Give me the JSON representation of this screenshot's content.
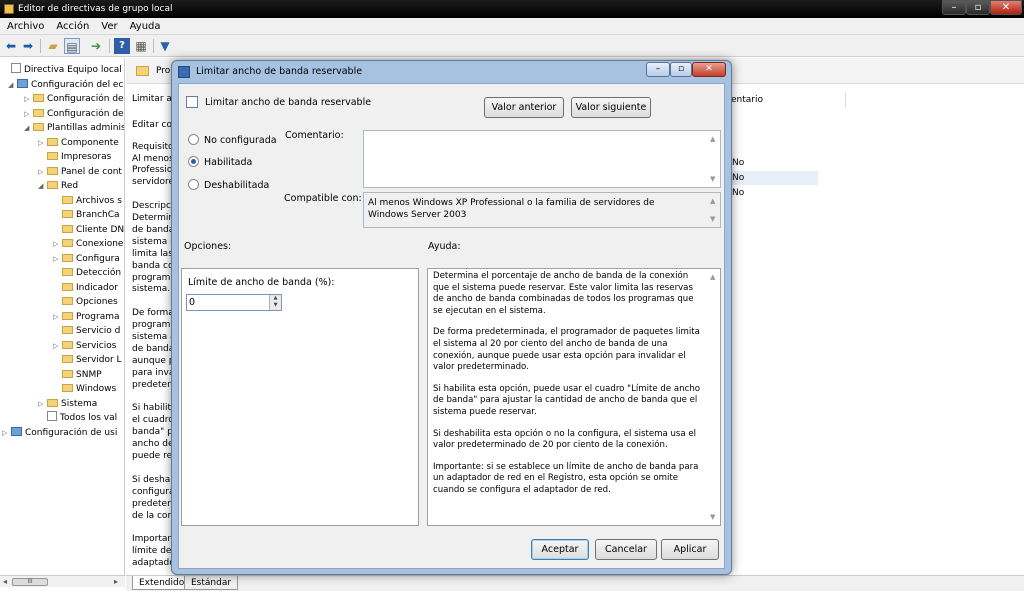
{
  "window": {
    "title": "Editor de directivas de grupo local",
    "minimize": "–",
    "maximize": "▫",
    "close": "✕"
  },
  "menu": {
    "items": [
      "Archivo",
      "Acción",
      "Ver",
      "Ayuda"
    ]
  },
  "toolbar": {
    "icons": [
      "back-arrow-icon",
      "forward-arrow-icon",
      "up-folder-icon",
      "show-hide-tree-icon",
      "export-list-icon",
      "help-icon",
      "properties-icon",
      "filter-icon"
    ]
  },
  "tree": {
    "items": [
      {
        "label": "Directiva Equipo local",
        "level": 0,
        "icon": "doc",
        "exp": ""
      },
      {
        "label": "Configuración del ec",
        "level": 1,
        "icon": "comp",
        "exp": "◢"
      },
      {
        "label": "Configuración de",
        "level": 2,
        "icon": "fold",
        "exp": "▷"
      },
      {
        "label": "Configuración de",
        "level": 2,
        "icon": "fold",
        "exp": "▷"
      },
      {
        "label": "Plantillas adminis",
        "level": 2,
        "icon": "fold",
        "exp": "◢"
      },
      {
        "label": "Componente",
        "level": 3,
        "icon": "fold",
        "exp": "▷"
      },
      {
        "label": "Impresoras",
        "level": 3,
        "icon": "fold",
        "exp": ""
      },
      {
        "label": "Panel de cont",
        "level": 3,
        "icon": "fold",
        "exp": "▷"
      },
      {
        "label": "Red",
        "level": 3,
        "icon": "fold",
        "exp": "◢"
      },
      {
        "label": "Archivos s",
        "level": 4,
        "icon": "fold",
        "exp": ""
      },
      {
        "label": "BranchCa",
        "level": 4,
        "icon": "fold",
        "exp": ""
      },
      {
        "label": "Cliente DN",
        "level": 4,
        "icon": "fold",
        "exp": ""
      },
      {
        "label": "Conexione",
        "level": 4,
        "icon": "fold",
        "exp": "▷"
      },
      {
        "label": "Configura",
        "level": 4,
        "icon": "fold",
        "exp": "▷"
      },
      {
        "label": "Detección",
        "level": 4,
        "icon": "fold",
        "exp": ""
      },
      {
        "label": "Indicador",
        "level": 4,
        "icon": "fold",
        "exp": ""
      },
      {
        "label": "Opciones",
        "level": 4,
        "icon": "fold",
        "exp": ""
      },
      {
        "label": "Programa",
        "level": 4,
        "icon": "fold",
        "exp": "▷"
      },
      {
        "label": "Servicio d",
        "level": 4,
        "icon": "fold",
        "exp": ""
      },
      {
        "label": "Servicios",
        "level": 4,
        "icon": "fold",
        "exp": "▷"
      },
      {
        "label": "Servidor L",
        "level": 4,
        "icon": "fold",
        "exp": ""
      },
      {
        "label": "SNMP",
        "level": 4,
        "icon": "fold",
        "exp": ""
      },
      {
        "label": "Windows",
        "level": 4,
        "icon": "fold",
        "exp": ""
      },
      {
        "label": "Sistema",
        "level": 3,
        "icon": "fold",
        "exp": "▷"
      },
      {
        "label": "Todos los val",
        "level": 3,
        "icon": "doc",
        "exp": ""
      },
      {
        "label": "Configuración de usi",
        "level": 0,
        "icon": "comp",
        "exp": "▷"
      }
    ],
    "scroll_thumb": "III"
  },
  "rightpane": {
    "header_title": "Pro",
    "column_header": "entario",
    "values": [
      "No",
      "No",
      "No"
    ],
    "text_lines": [
      "Limitar a",
      "",
      "Editar co",
      "",
      "Requisito",
      "Al menos",
      "Professio",
      "servidore",
      "",
      "Descripci",
      "Determin",
      "de banda",
      "sistema p",
      "limita las",
      "banda co",
      "programa",
      "sistema.",
      "",
      "De forma",
      "programa",
      "sistema a",
      "de banda",
      "aunque p",
      "para inva",
      "predeterr",
      "",
      "Si habilita",
      "el cuadro",
      "banda\" p",
      "ancho de",
      "puede res",
      "",
      "Si deshab",
      "configura",
      "predeterr",
      "de la con",
      "",
      "Importan",
      "límite de",
      "adaptador"
    ]
  },
  "tabs": [
    "Extendido",
    "Estándar"
  ],
  "dialog": {
    "title": "Limitar ancho de banda reservable",
    "policy_name": "Limitar ancho de banda reservable",
    "prev_button": "Valor anterior",
    "next_button": "Valor siguiente",
    "options": [
      "No configurada",
      "Habilitada",
      "Deshabilitada"
    ],
    "selected_option": 1,
    "comment_label": "Comentario:",
    "comment_value": "",
    "compatible_label": "Compatible con:",
    "compatible_value": "Al menos Windows XP Professional o la familia de servidores de Windows Server 2003",
    "options_label": "Opciones:",
    "help_label": "Ayuda:",
    "bandwidth_label": "Límite de ancho de banda (%):",
    "bandwidth_value": "0",
    "help_paragraphs": [
      "Determina el porcentaje de ancho de banda de la conexión que el sistema puede reservar. Este valor limita las reservas de ancho de banda combinadas de todos los programas que se ejecutan en el sistema.",
      "De forma predeterminada, el programador de paquetes limita el sistema al 20 por ciento del ancho de banda de una conexión, aunque puede usar esta opción para invalidar el valor predeterminado.",
      "Si habilita esta opción, puede usar el cuadro \"Límite de ancho de banda\" para ajustar la cantidad de ancho de banda que el sistema puede reservar.",
      "Si deshabilita esta opción o no la configura, el sistema usa el valor predeterminado de 20 por ciento de la conexión.",
      "Importante: si se establece un límite de ancho de banda para un adaptador de red en el Registro, esta opción se omite cuando se configura el adaptador de red."
    ],
    "ok_button": "Aceptar",
    "cancel_button": "Cancelar",
    "apply_button": "Aplicar"
  }
}
